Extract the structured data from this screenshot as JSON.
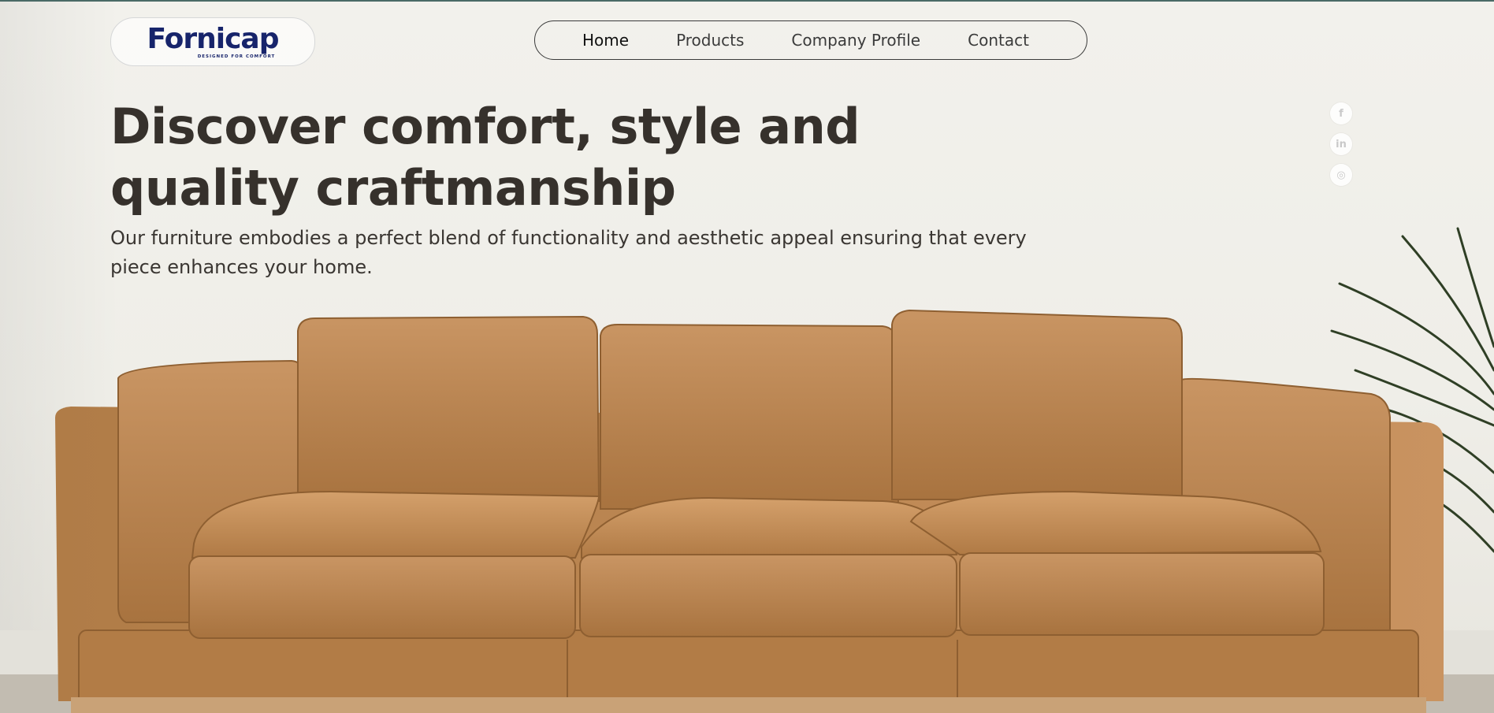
{
  "brand": {
    "name": "Fornicap",
    "tagline": "DESIGNED FOR COMFORT"
  },
  "nav": {
    "items": [
      {
        "label": "Home",
        "active": true
      },
      {
        "label": "Products"
      },
      {
        "label": "Company Profile"
      },
      {
        "label": "Contact"
      }
    ]
  },
  "hero": {
    "headline": "Discover comfort, style and quality craftmanship",
    "subtitle": "Our furniture embodies a perfect blend of functionality and aesthetic appeal ensuring that every piece enhances your home."
  },
  "social": [
    {
      "icon": "facebook-icon",
      "glyph": "f"
    },
    {
      "icon": "linkedin-icon",
      "glyph": "in"
    },
    {
      "icon": "instagram-icon",
      "glyph": "◎"
    }
  ],
  "colors": {
    "brand_navy": "#17246b",
    "brand_red": "#c81c22",
    "headline": "#36312c",
    "sofa_leather": "#b7834f"
  }
}
